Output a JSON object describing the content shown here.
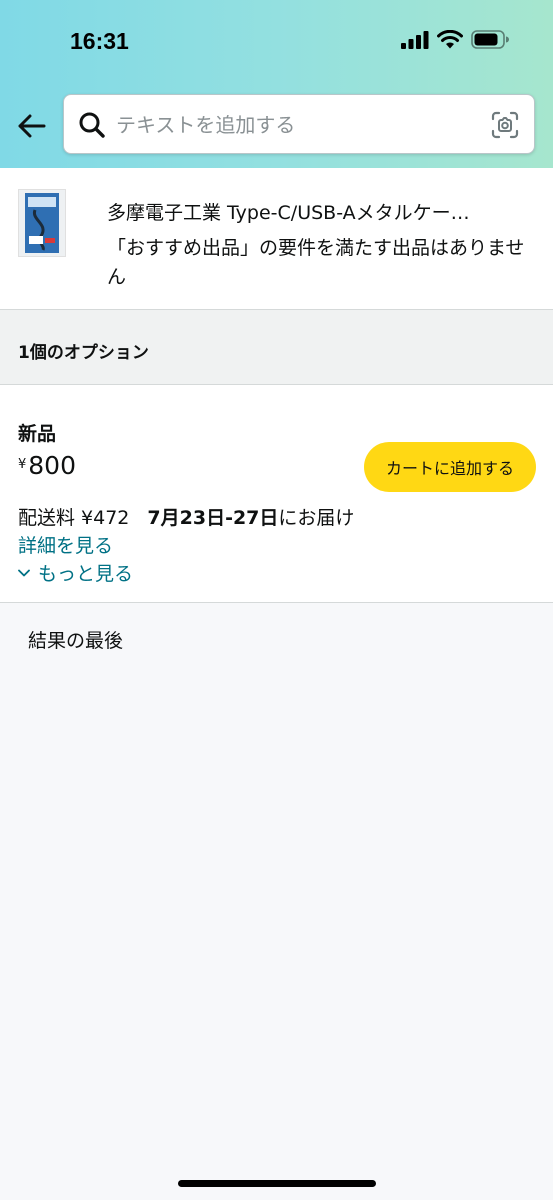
{
  "status_bar": {
    "time": "16:31"
  },
  "search": {
    "placeholder": "テキストを追加する",
    "value": ""
  },
  "product": {
    "title": "多摩電子工業 Type-C/USB-Aメタルケー…",
    "note": "「おすすめ出品」の要件を満たす出品はありません"
  },
  "options": {
    "header": "1個のオプション"
  },
  "offer": {
    "condition": "新品",
    "price_symbol": "¥",
    "price": "800",
    "add_to_cart": "カートに追加する",
    "shipping": "配送料 ¥472",
    "delivery_date": "7月23日-27日",
    "delivery_suffix": "にお届け",
    "details_link": "詳細を見る",
    "more_link": "もっと見る"
  },
  "end_of_results": "結果の最後",
  "colors": {
    "header_gradient_start": "#80d9e6",
    "header_gradient_end": "#a6e6ce",
    "cart_button": "#ffd814",
    "link": "#007185"
  }
}
